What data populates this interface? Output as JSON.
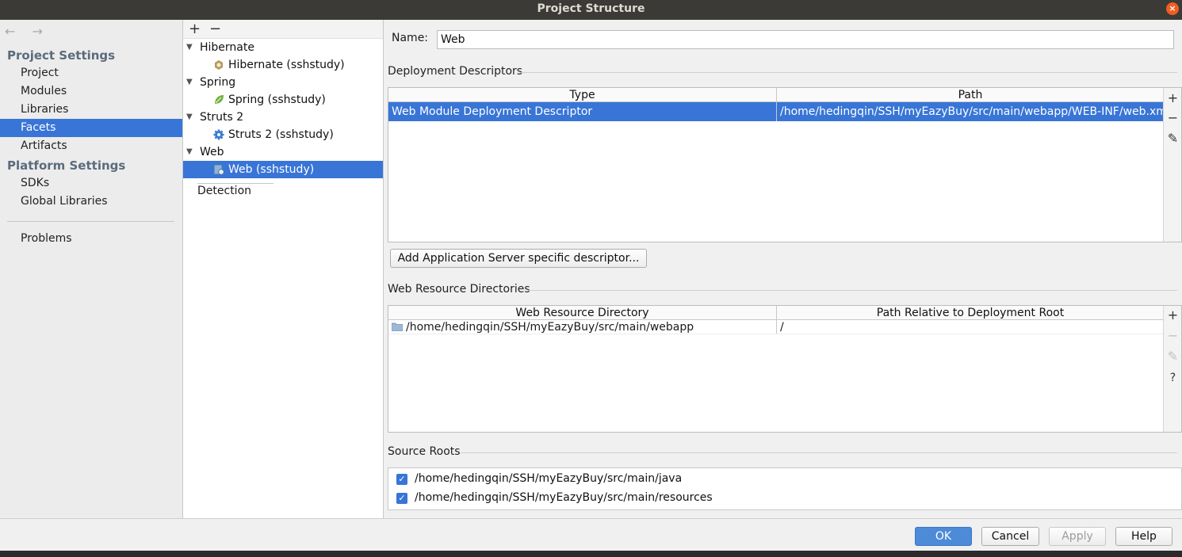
{
  "window": {
    "title": "Project Structure",
    "close_glyph": "×"
  },
  "sidebar": {
    "back_arrow": "←",
    "forward_arrow": "→",
    "project_settings_label": "Project Settings",
    "project_items": [
      {
        "label": "Project"
      },
      {
        "label": "Modules"
      },
      {
        "label": "Libraries"
      },
      {
        "label": "Facets",
        "selected": true
      },
      {
        "label": "Artifacts"
      }
    ],
    "platform_settings_label": "Platform Settings",
    "platform_items": [
      {
        "label": "SDKs"
      },
      {
        "label": "Global Libraries"
      }
    ],
    "problems_label": "Problems"
  },
  "facet_tree": {
    "add_glyph": "+",
    "remove_glyph": "−",
    "groups": [
      {
        "label": "Hibernate",
        "child": "Hibernate (sshstudy)",
        "icon": "hibernate-icon"
      },
      {
        "label": "Spring",
        "child": "Spring (sshstudy)",
        "icon": "spring-leaf-icon"
      },
      {
        "label": "Struts 2",
        "child": "Struts 2 (sshstudy)",
        "icon": "gear-icon"
      },
      {
        "label": "Web",
        "child": "Web (sshstudy)",
        "icon": "web-module-icon",
        "selected": true
      }
    ],
    "detection_label": "Detection"
  },
  "facet": {
    "name_label": "Name:",
    "name_value": "Web",
    "deployment_title": "Deployment Descriptors",
    "deployment_columns": [
      "Type",
      "Path"
    ],
    "deployment_rows": [
      {
        "type": "Web Module Deployment Descriptor",
        "path": "/home/hedingqin/SSH/myEazyBuy/src/main/webapp/WEB-INF/web.xm"
      }
    ],
    "add_descriptor_button": "Add Application Server specific descriptor...",
    "resources_title": "Web Resource Directories",
    "resources_columns": [
      "Web Resource Directory",
      "Path Relative to Deployment Root"
    ],
    "resources_rows": [
      {
        "dir": "/home/hedingqin/SSH/myEazyBuy/src/main/webapp",
        "relative": "/"
      }
    ],
    "table_tools": {
      "add": "+",
      "remove": "−",
      "edit": "✎",
      "help": "?"
    },
    "source_roots_title": "Source Roots",
    "source_roots": [
      {
        "path": "/home/hedingqin/SSH/myEazyBuy/src/main/java",
        "checked": true
      },
      {
        "path": "/home/hedingqin/SSH/myEazyBuy/src/main/resources",
        "checked": true
      }
    ],
    "check_glyph": "✓"
  },
  "footer": {
    "ok": "OK",
    "cancel": "Cancel",
    "apply": "Apply",
    "help": "Help"
  },
  "colors": {
    "selection": "#3875d7",
    "primary_button": "#4d8ad7",
    "titlebar": "#3b3a36",
    "close_button": "#f15d22"
  }
}
